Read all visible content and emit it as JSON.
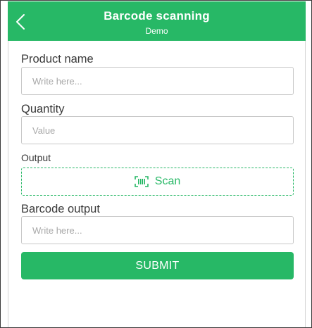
{
  "header": {
    "title": "Barcode scanning",
    "subtitle": "Demo",
    "back_icon": "chevron-left-icon",
    "background_color": "#27b866"
  },
  "form": {
    "product_name": {
      "label": "Product name",
      "placeholder": "Write here..."
    },
    "quantity": {
      "label": "Quantity",
      "placeholder": "Value"
    },
    "output": {
      "label": "Output",
      "scan_label": "Scan",
      "scan_icon": "barcode-scan-icon"
    },
    "barcode_output": {
      "label": "Barcode output",
      "placeholder": "Write here..."
    },
    "submit_label": "SUBMIT"
  },
  "colors": {
    "accent": "#27b866",
    "text": "#3a3a3a",
    "border": "#c8c8c8"
  }
}
